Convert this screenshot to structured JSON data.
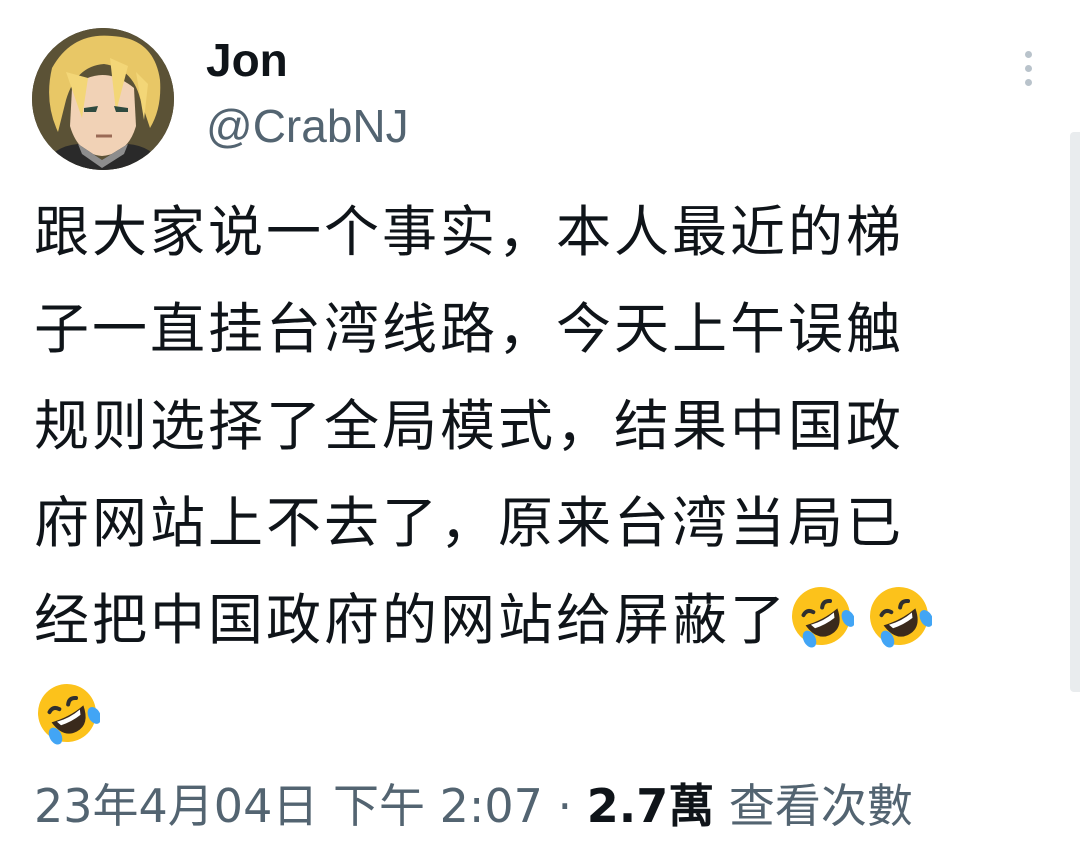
{
  "author": {
    "display_name": "Jon",
    "handle": "@CrabNJ",
    "avatar_icon": "anime-character-avatar-icon"
  },
  "menu": {
    "icon": "more-vertical-icon"
  },
  "tweet": {
    "lines": [
      "跟大家说一个事实，本人最近的梯",
      "子一直挂台湾线路，今天上午误触",
      "规则选择了全局模式，结果中国政",
      "府网站上不去了，原来台湾当局已",
      "经把中国政府的网站给屏蔽了"
    ],
    "emoji_icon": "rolling-on-floor-laughing-emoji-icon",
    "emoji_count": 3
  },
  "meta": {
    "timestamp": "23年4月04日 下午 2:07",
    "separator": "·",
    "views_count": "2.7萬",
    "views_label": "查看次數"
  },
  "colors": {
    "text_primary": "#0f1419",
    "text_secondary": "#536471",
    "emoji_face": "#fcc21b",
    "emoji_tear": "#42a5f5"
  }
}
